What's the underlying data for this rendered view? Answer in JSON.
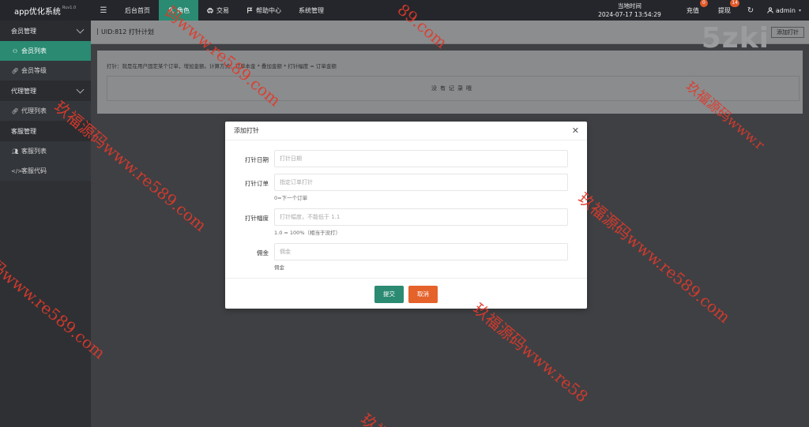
{
  "topbar": {
    "brand": "app优化系统",
    "brand_version": "Ruv1.0",
    "menu_toggle": "☰",
    "nav": [
      {
        "label": "后台首页",
        "icon": "none"
      },
      {
        "label": "角色",
        "icon": "user-icon"
      },
      {
        "label": "交易",
        "icon": "car-icon"
      },
      {
        "label": "帮助中心",
        "icon": "flag-icon"
      },
      {
        "label": "系统管理",
        "icon": "none"
      }
    ],
    "clock_label": "当地时间",
    "clock_value": "2024-07-17 13:54:29",
    "recharge_label": "充值",
    "recharge_badge": "0",
    "withdraw_label": "提现",
    "withdraw_badge": "14",
    "refresh_icon": "↻",
    "user": "admin",
    "badge_color": "#e15a2b",
    "accent_color": "#2a8a72"
  },
  "sidebar": {
    "groups": [
      {
        "label": "会员管理",
        "items": [
          {
            "label": "会员列表",
            "icon": "user-icon",
            "active": true
          },
          {
            "label": "会员等级",
            "icon": "link-icon"
          }
        ]
      },
      {
        "label": "代理管理",
        "items": [
          {
            "label": "代理列表",
            "icon": "link-icon"
          }
        ]
      },
      {
        "label": "客服管理",
        "items": [
          {
            "label": "客服列表",
            "icon": "users-icon"
          },
          {
            "label": "客服代码",
            "icon": "code-icon"
          }
        ]
      }
    ]
  },
  "page": {
    "title": "UID:812 打针计划",
    "add_button": "添加打针",
    "logo": "5zki",
    "hint": "打针：就是在用户固定某个订单，增加金额。计算方式：订单本金 * 叠加金额 * 打针幅度 = 订单金额",
    "no_record": "没有记录哦"
  },
  "modal": {
    "title": "添加打针",
    "close": "✕",
    "fields": [
      {
        "label": "打针日期",
        "placeholder": "打针日期",
        "help": ""
      },
      {
        "label": "打针订单",
        "placeholder": "指定订单打针",
        "help": "0=下一个订单"
      },
      {
        "label": "打针幅度",
        "placeholder": "打针幅度，不能低于 1.1",
        "help": "1.0 = 100%（相当于没打）"
      },
      {
        "label": "佣金",
        "placeholder": "佣金",
        "help": "佣金"
      }
    ],
    "submit": "提交",
    "cancel": "取消"
  },
  "watermarks": {
    "text": "玖福源码www.re589.com",
    "fragment_1": "码www.re589.com",
    "fragment_2": "玖福源码www.re589.com",
    "fragment_3": "玖福源码www.re58",
    "fragment_4": "玖福源码www.re589.com",
    "fragment_5": "码www.re589.com",
    "fragment_6": "玖福源码www.re589.com",
    "fragment_7": "玖福源码www.r",
    "fragment_8": "玖福",
    "fragment_9": "89.com"
  }
}
